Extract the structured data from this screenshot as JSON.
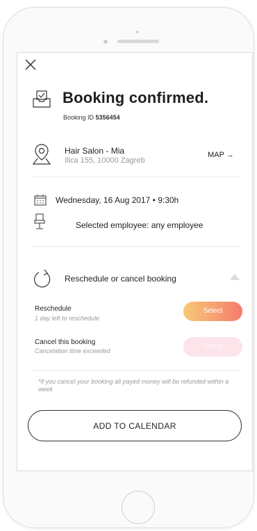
{
  "header": {
    "close_icon": "close-icon"
  },
  "confirmation": {
    "title": "Booking confirmed.",
    "booking_id_label": "Booking ID",
    "booking_id_value": "5356454",
    "icon": "tray-check-icon"
  },
  "salon": {
    "name": "Hair Salon - Mia",
    "address": "Ilica 155, 10000 Zagreb",
    "map_label": "MAP →",
    "icon": "location-pin-icon"
  },
  "appointment": {
    "date_time": "Wednesday, 16 Aug 2017 • 9:30h",
    "employee": "Selected employee: any employee",
    "calendar_icon": "calendar-icon",
    "employee_icon": "chair-icon"
  },
  "manage": {
    "title": "Reschedule or cancel booking",
    "icon": "refresh-icon",
    "toggle_icon": "triangle-up-icon",
    "reschedule": {
      "label": "Reschedule",
      "sub": "1 day left to reschedule",
      "button": "Select"
    },
    "cancel": {
      "label": "Cancel this booking",
      "sub": "Cancelation time exceeded",
      "button": "Select"
    },
    "note": "*if you cancel your booking all payed money will be refunded within a week"
  },
  "footer": {
    "add_to_calendar": "ADD TO CALENDAR"
  },
  "colors": {
    "accent_start": "#f8c977",
    "accent_end": "#f57c6c",
    "disabled": "#fde3ea",
    "muted_text": "#9a9a9a"
  }
}
